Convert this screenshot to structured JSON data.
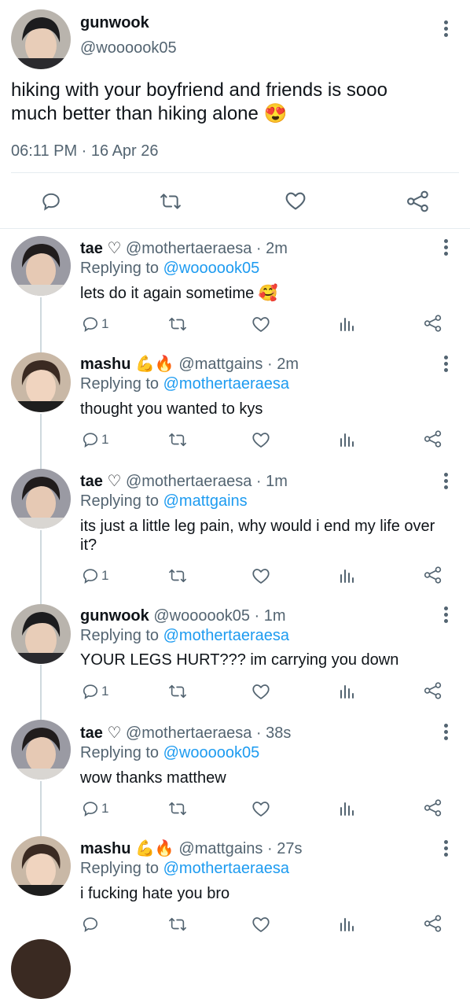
{
  "colors": {
    "link": "#1d9bf0",
    "muted": "#536471",
    "heart_emoji": "#e0245e"
  },
  "main_tweet": {
    "name": "gunwook",
    "handle": "@woooook05",
    "text_line1": "hiking with your boyfriend and friends is sooo",
    "text_line2": "much better than hiking alone",
    "emoji": "😍",
    "timestamp": "06:11 PM · 16 Apr 26"
  },
  "replies": [
    {
      "name": "tae",
      "badge": "♡",
      "handle": "@mothertaeraesa",
      "time": "· 2m",
      "replying_prefix": "Replying to",
      "replying_to": "@woooook05",
      "text": "lets do it again sometime",
      "emoji": "🥰",
      "reply_count": "1"
    },
    {
      "name": "mashu",
      "badge": "💪🔥",
      "handle": "@mattgains",
      "time": "· 2m",
      "replying_prefix": "Replying to",
      "replying_to": "@mothertaeraesa",
      "text": "thought you wanted to kys",
      "reply_count": "1"
    },
    {
      "name": "tae",
      "badge": "♡",
      "handle": "@mothertaeraesa",
      "time": "· 1m",
      "replying_prefix": "Replying to",
      "replying_to": "@mattgains",
      "text_line1": "its just a little leg pain, why would i end my life over",
      "text_line2": "it?",
      "reply_count": "1"
    },
    {
      "name": "gunwook",
      "handle": "@woooook05",
      "time": "· 1m",
      "replying_prefix": "Replying to",
      "replying_to": "@mothertaeraesa",
      "text": "YOUR LEGS HURT??? im carrying you down",
      "reply_count": "1"
    },
    {
      "name": "tae",
      "badge": "♡",
      "handle": "@mothertaeraesa",
      "time": "· 38s",
      "replying_prefix": "Replying to",
      "replying_to": "@woooook05",
      "text": "wow thanks matthew",
      "reply_count": "1"
    },
    {
      "name": "mashu",
      "badge": "💪🔥",
      "handle": "@mattgains",
      "time": "· 27s",
      "replying_prefix": "Replying to",
      "replying_to": "@mothertaeraesa",
      "text": "i fucking hate you bro",
      "reply_count": ""
    }
  ]
}
